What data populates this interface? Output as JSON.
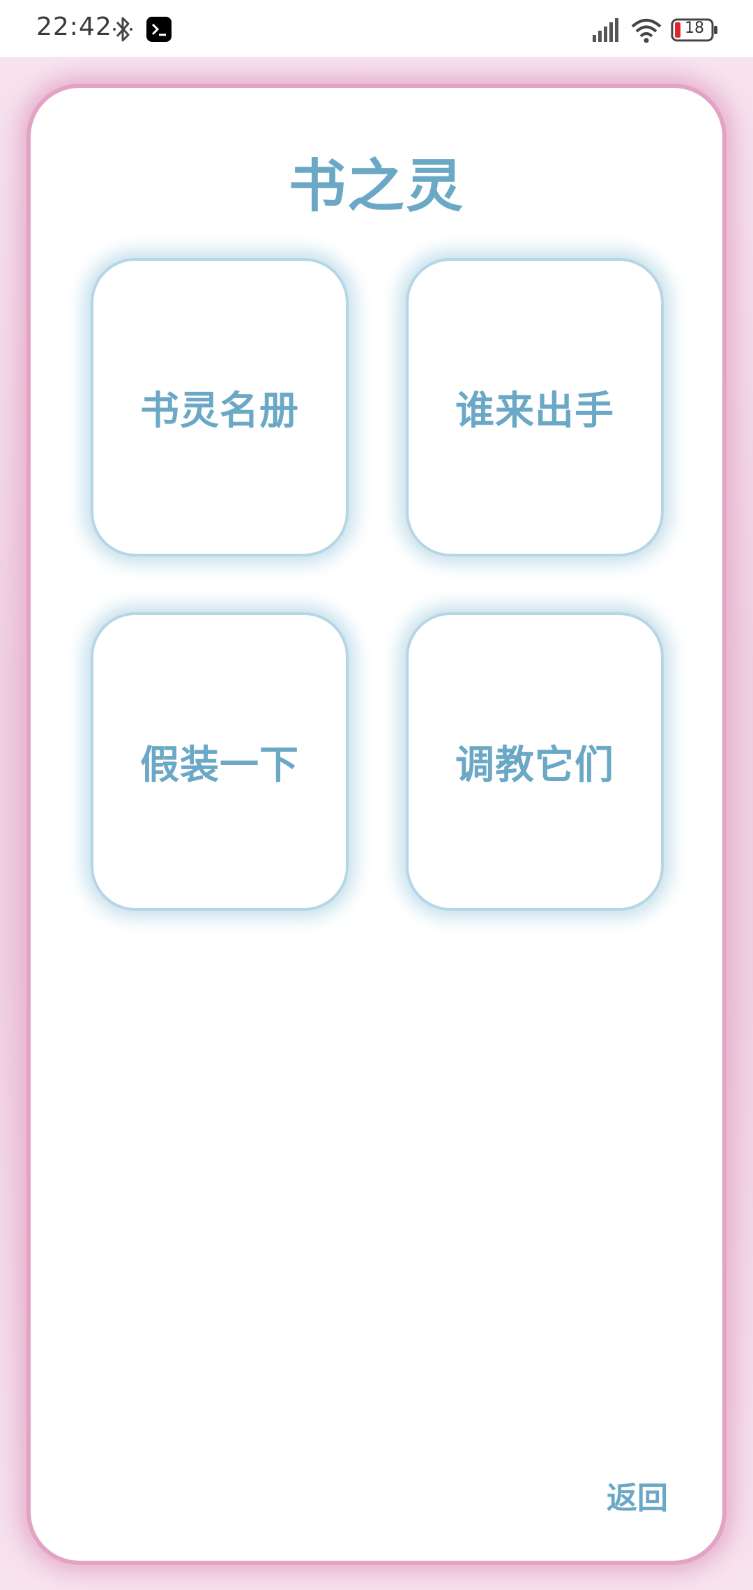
{
  "status_bar": {
    "time": "22:42",
    "battery_level": "18",
    "icons": [
      "bluetooth-icon",
      "terminal-app-icon",
      "signal-icon",
      "wifi-icon",
      "battery-icon"
    ]
  },
  "main": {
    "title": "书之灵",
    "tiles": [
      {
        "label": "书灵名册"
      },
      {
        "label": "谁来出手"
      },
      {
        "label": "假装一下"
      },
      {
        "label": "调教它们"
      }
    ],
    "back_label": "返回"
  },
  "colors": {
    "accent": "#6aa8c6",
    "frame_glow": "#e3a3c4",
    "tile_glow": "#b6d6e6"
  }
}
